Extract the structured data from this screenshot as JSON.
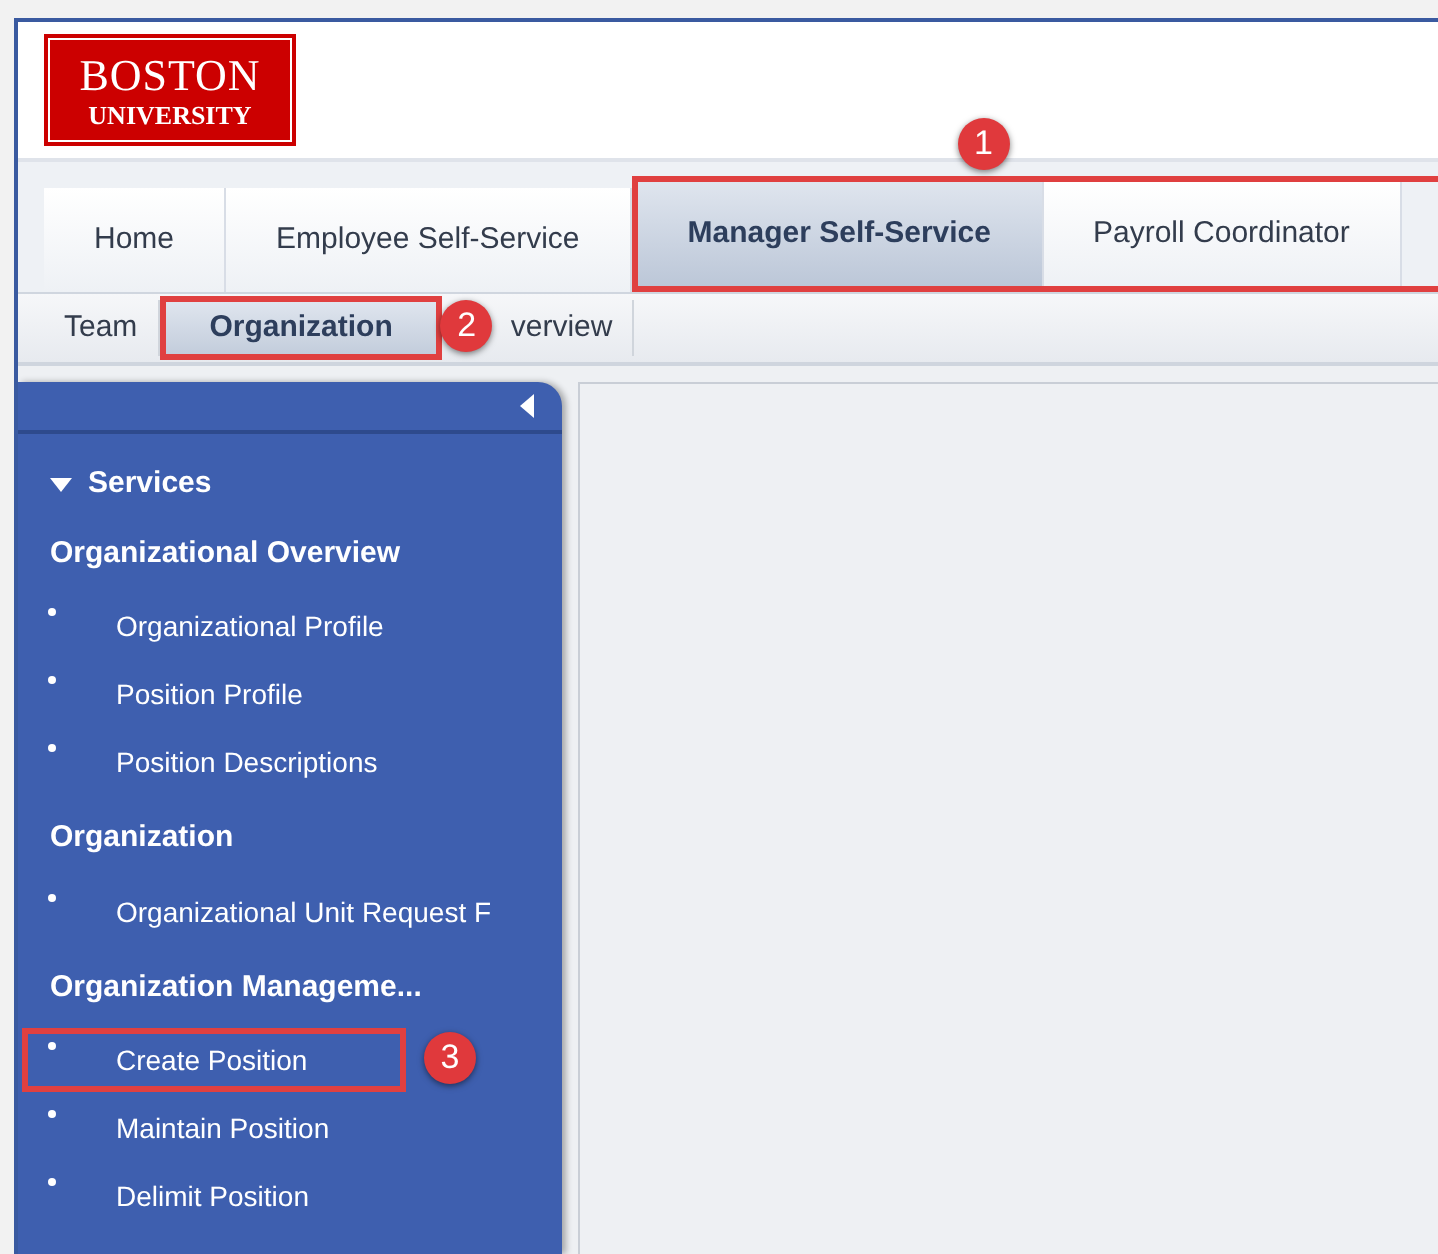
{
  "logo": {
    "line_1": "BOSTON",
    "line_2": "UNIVERSITY"
  },
  "tabs": [
    {
      "label": "Home",
      "selected": false,
      "highlighted": false
    },
    {
      "label": "Employee Self-Service",
      "selected": false,
      "highlighted": false
    },
    {
      "label": "Manager Self-Service",
      "selected": true,
      "highlighted": true
    },
    {
      "label": "Payroll Coordinator",
      "selected": false,
      "highlighted": true
    }
  ],
  "tabs_badge": "1",
  "subtabs": [
    {
      "label": "Team",
      "selected": false,
      "highlighted": false
    },
    {
      "label": "Organization",
      "selected": true,
      "highlighted": true,
      "badge": "2"
    },
    {
      "label": "verview",
      "selected": false,
      "highlighted": false
    }
  ],
  "sidebar": {
    "title": "Services",
    "expanded": true,
    "groups": [
      {
        "heading": "Organizational Overview",
        "items": [
          {
            "label": "Organizational Profile",
            "highlighted": false
          },
          {
            "label": "Position Profile",
            "highlighted": false
          },
          {
            "label": "Position Descriptions",
            "highlighted": false
          }
        ]
      },
      {
        "heading": "Organization",
        "items": [
          {
            "label": "Organizational Unit Request F",
            "highlighted": false
          }
        ]
      },
      {
        "heading": "Organization Manageme...",
        "items": [
          {
            "label": "Create Position",
            "highlighted": true,
            "badge": "3"
          },
          {
            "label": "Maintain Position",
            "highlighted": false
          },
          {
            "label": "Delimit Position",
            "highlighted": false
          }
        ]
      }
    ]
  }
}
